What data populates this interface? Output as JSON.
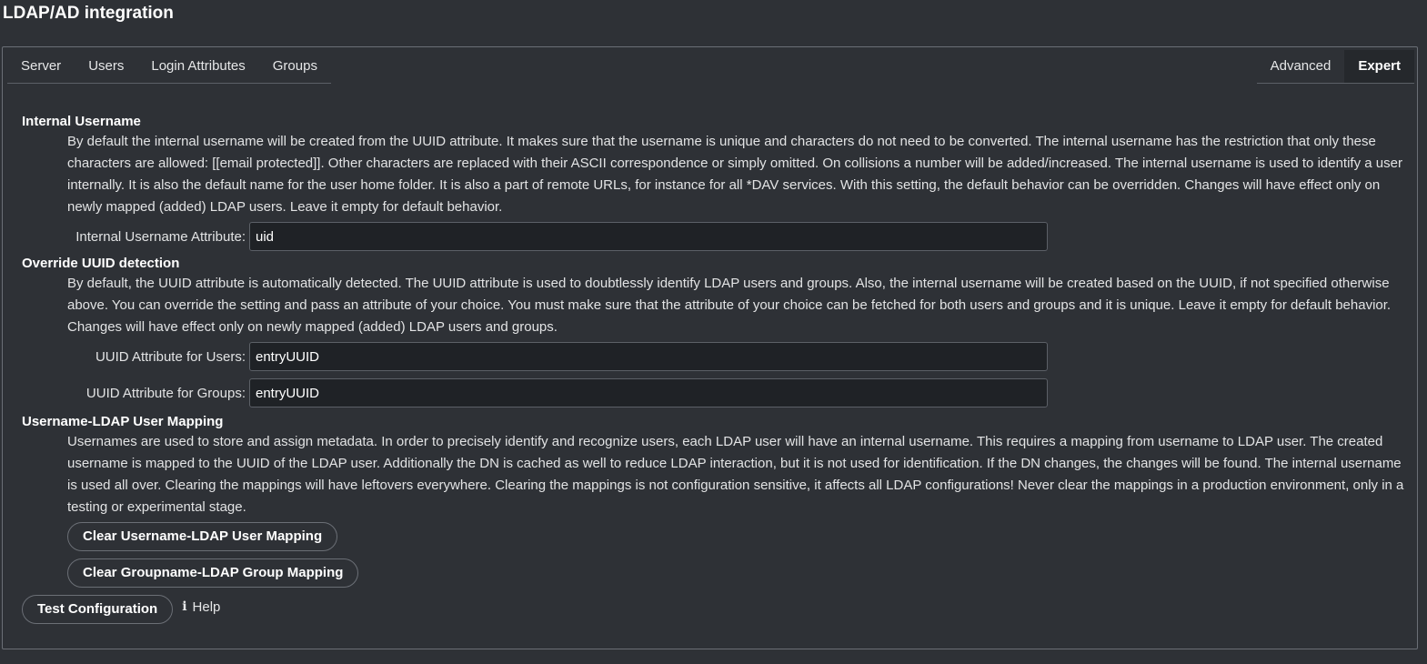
{
  "page": {
    "title": "LDAP/AD integration"
  },
  "tabs_left": [
    "Server",
    "Users",
    "Login Attributes",
    "Groups"
  ],
  "tabs_right": [
    "Advanced",
    "Expert"
  ],
  "active_tab": "Expert",
  "internal_username": {
    "title": "Internal Username",
    "description": "By default the internal username will be created from the UUID attribute. It makes sure that the username is unique and characters do not need to be converted. The internal username has the restriction that only these characters are allowed: [[email protected]]. Other characters are replaced with their ASCII correspondence or simply omitted. On collisions a number will be added/increased. The internal username is used to identify a user internally. It is also the default name for the user home folder. It is also a part of remote URLs, for instance for all *DAV services. With this setting, the default behavior can be overridden. Changes will have effect only on newly mapped (added) LDAP users. Leave it empty for default behavior.",
    "attribute_label": "Internal Username Attribute:",
    "attribute_value": "uid"
  },
  "override_uuid": {
    "title": "Override UUID detection",
    "description": "By default, the UUID attribute is automatically detected. The UUID attribute is used to doubtlessly identify LDAP users and groups. Also, the internal username will be created based on the UUID, if not specified otherwise above. You can override the setting and pass an attribute of your choice. You must make sure that the attribute of your choice can be fetched for both users and groups and it is unique. Leave it empty for default behavior. Changes will have effect only on newly mapped (added) LDAP users and groups.",
    "users_label": "UUID Attribute for Users:",
    "users_value": "entryUUID",
    "groups_label": "UUID Attribute for Groups:",
    "groups_value": "entryUUID"
  },
  "user_mapping": {
    "title": "Username-LDAP User Mapping",
    "description": "Usernames are used to store and assign metadata. In order to precisely identify and recognize users, each LDAP user will have an internal username. This requires a mapping from username to LDAP user. The created username is mapped to the UUID of the LDAP user. Additionally the DN is cached as well to reduce LDAP interaction, but it is not used for identification. If the DN changes, the changes will be found. The internal username is used all over. Clearing the mappings will have leftovers everywhere. Clearing the mappings is not configuration sensitive, it affects all LDAP configurations! Never clear the mappings in a production environment, only in a testing or experimental stage.",
    "clear_user_button": "Clear Username-LDAP User Mapping",
    "clear_group_button": "Clear Groupname-LDAP Group Mapping"
  },
  "footer": {
    "test_button": "Test Configuration",
    "help_icon": "i",
    "help_label": "Help"
  },
  "colors": {
    "background": "#2e3136",
    "input_background": "#1f2226",
    "border": "#6b6f76",
    "active_tab": "#25282c"
  }
}
